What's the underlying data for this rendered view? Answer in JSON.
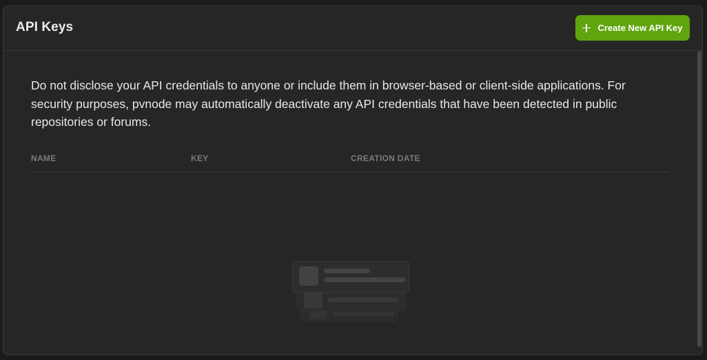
{
  "header": {
    "title": "API Keys",
    "create_button_label": "Create New API Key"
  },
  "notice": {
    "text": "Do not disclose your API credentials to anyone or include them in browser-based or client-side applications. For security purposes, pvnode may automatically deactivate any API credentials that have been detected in public repositories or forums."
  },
  "table": {
    "columns": [
      "NAME",
      "KEY",
      "CREATION DATE"
    ],
    "rows": []
  },
  "colors": {
    "accent": "#5fa50d",
    "background": "#262626",
    "border": "#3a3a3a"
  },
  "icons": {
    "create_button": "plus-icon",
    "empty_state": "empty-list-illustration"
  }
}
